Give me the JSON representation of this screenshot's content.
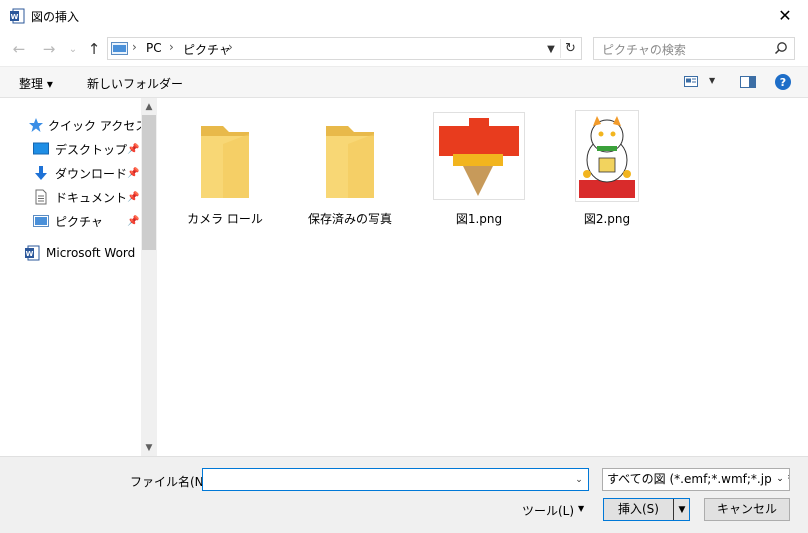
{
  "window": {
    "title": "図の挿入",
    "close": "✕",
    "app_icon_letter": "W",
    "app_icon_color": "#2b579a"
  },
  "nav": {
    "back": "←",
    "forward": "→",
    "recent": "⌄",
    "up": "↑",
    "breadcrumb": [
      "PC",
      "ピクチャ"
    ],
    "separator": "›",
    "refresh": "↻",
    "search_placeholder": "ピクチャの検索"
  },
  "toolbar": {
    "organize": "整理 ▾",
    "new_folder": "新しいフォルダー",
    "help": "?"
  },
  "sidebar": {
    "quick_access": "クイック アクセス",
    "items": [
      {
        "label": "デスクトップ",
        "icon": "desktop-icon",
        "pinned": true
      },
      {
        "label": "ダウンロード",
        "icon": "download-icon",
        "pinned": true
      },
      {
        "label": "ドキュメント",
        "icon": "document-icon",
        "pinned": true
      },
      {
        "label": "ピクチャ",
        "icon": "pictures-icon",
        "pinned": true
      }
    ],
    "word": "Microsoft Word",
    "pin_glyph": "📌"
  },
  "files": [
    {
      "name": "カメラ ロール",
      "type": "folder"
    },
    {
      "name": "保存済みの写真",
      "type": "folder"
    },
    {
      "name": "図1.png",
      "type": "image-top"
    },
    {
      "name": "図2.png",
      "type": "image-cat"
    }
  ],
  "bottom": {
    "filename_label": "ファイル名(N):",
    "filename_value": "",
    "filter_value": "すべての図 (*.emf;*.wmf;*.jpg;*.jp",
    "tools": "ツール(L)",
    "insert": "挿入(S)",
    "cancel": "キャンセル"
  },
  "colors": {
    "accent": "#0078d7",
    "folder": "#f8d775",
    "folder_dark": "#e8b94a",
    "help": "#1e6ec8",
    "quick_access_star": "#3a8ee6"
  }
}
